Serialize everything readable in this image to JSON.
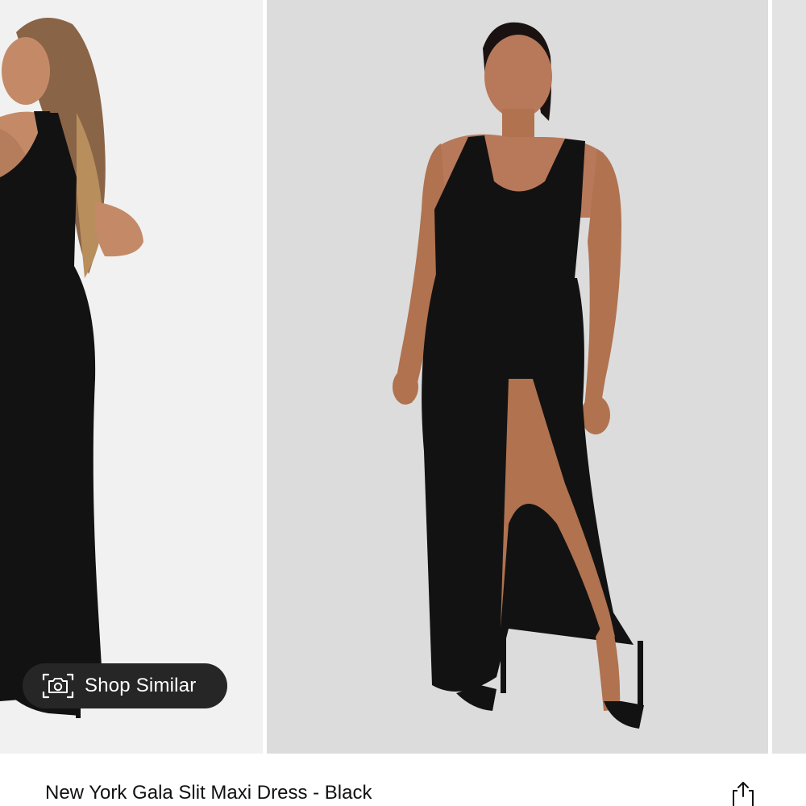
{
  "gallery": {
    "images": [
      {
        "icon": "model-back-view-photo",
        "background": "#f1f1f1"
      },
      {
        "icon": "model-front-view-photo",
        "background": "#dcdcdc"
      },
      {
        "icon": "partial-next-photo",
        "background": "#e3e3e3"
      }
    ],
    "shop_similar": {
      "label": "Shop Similar",
      "icon": "camera-icon"
    }
  },
  "product": {
    "title": "New York Gala Slit Maxi Dress - Black",
    "share_icon": "share-icon"
  },
  "colors": {
    "dress": "#121212",
    "skin": "#c48a68",
    "button_bg": "#262626",
    "text": "#111111"
  }
}
